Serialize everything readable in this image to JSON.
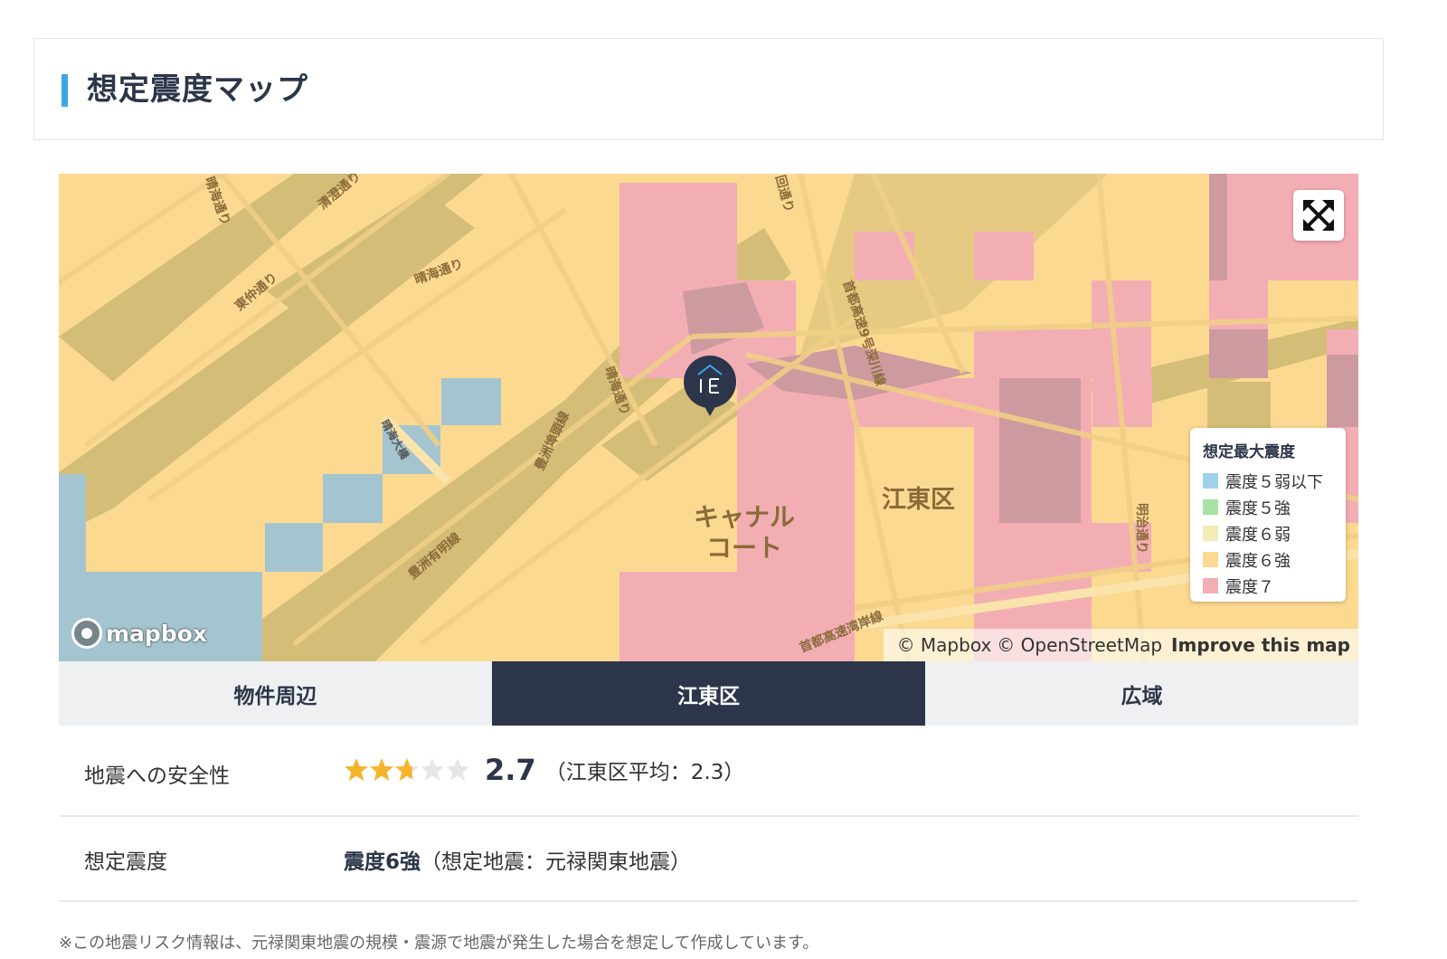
{
  "section": {
    "title": "想定震度マップ"
  },
  "map": {
    "area_labels": {
      "canal_court_line1": "キャナル",
      "canal_court_line2": "コート",
      "koto_ward": "江東区"
    },
    "road_labels": {
      "harumi_dori_1": "晴海通り",
      "harumi_dori_2": "晴海通り",
      "harumi_dori_3": "晴海通り",
      "tochu_dori": "東仲通り",
      "seikai_dori": "清澄通り",
      "harumi_ohashi": "晴海大橋",
      "toyosu_ariake": "豊洲有明線",
      "shuto_fukagawa": "首都高速9号深川線",
      "shuto_wangan": "首都高速湾岸線",
      "toyosu_kuchi": "豊洲埠頭線",
      "meiji_dori": "明治通り",
      "kiyosumi": "回通り"
    },
    "fullscreen_icon": "expand-arrows-icon",
    "pin_icon": "home-ie-pin-icon",
    "legend": {
      "title": "想定最大震度",
      "items": [
        {
          "label": "震度５弱以下",
          "color": "#9fd1ec"
        },
        {
          "label": "震度５強",
          "color": "#a8e3a4"
        },
        {
          "label": "震度６弱",
          "color": "#f2ecb4"
        },
        {
          "label": "震度６強",
          "color": "#fcd991"
        },
        {
          "label": "震度７",
          "color": "#f3aeb4"
        }
      ]
    },
    "logo": "mapbox",
    "attribution": {
      "mapbox": "© Mapbox",
      "osm": "© OpenStreetMap",
      "improve": "Improve this map"
    }
  },
  "tabs": [
    {
      "label": "物件周辺",
      "active": false
    },
    {
      "label": "江東区",
      "active": true
    },
    {
      "label": "広域",
      "active": false
    }
  ],
  "safety": {
    "label": "地震への安全性",
    "rating": 2.7,
    "max": 5,
    "score": "2.7",
    "average": "（江東区平均：2.3）",
    "star_color": "#f5b42a"
  },
  "intensity": {
    "label": "想定震度",
    "value": "震度6強",
    "detail": "（想定地震：元禄関東地震）"
  },
  "note": "※この地震リスク情報は、元禄関東地震の規模・震源で地震が発生した場合を想定して作成しています。"
}
